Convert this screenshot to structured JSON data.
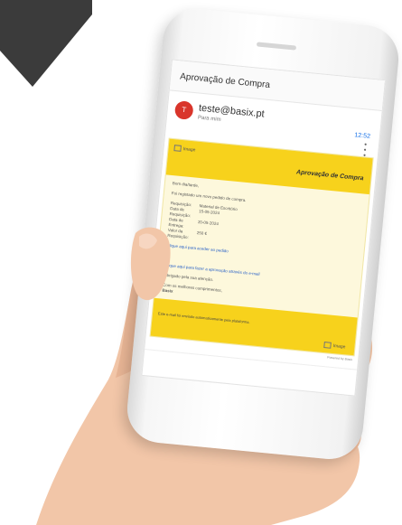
{
  "colors": {
    "arrow": "#3b3b3b",
    "email_header": "#f7d21c",
    "email_body_bg": "#fdf8dc",
    "avatar": "#d9352b",
    "skin": "#f2c6a8",
    "link": "#2a62c7"
  },
  "email_app": {
    "subject": "Aprovação de Compra",
    "sender": {
      "avatar_letter": "T",
      "email": "teste@basix.pt",
      "recipient": "Para mim",
      "date": "12:52"
    },
    "email": {
      "logo_alt": "Image",
      "title": "Aprovação de Compra",
      "greeting": "Bom dia/tarde,",
      "intro": "Foi registado um novo pedido de compra.",
      "details": [
        {
          "key": "Requisição:",
          "value": "Material de Escritório"
        },
        {
          "key": "Data de Requisição:",
          "value": "15-05-2024"
        },
        {
          "key": "Data de Entrega:",
          "value": "20-05-2024"
        },
        {
          "key": "Valor da Requisição:",
          "value": "250 €"
        }
      ],
      "link_1": "Clique aqui para aceder ao pedido",
      "separator": "ou",
      "link_2": "Clique aqui para fazer a aprovação através do e-mail",
      "closing_1": "Obrigado pela sua atenção.",
      "closing_2": "Com os melhores cumprimentos,",
      "signature": "Basix",
      "footer_text": "Este e-mail foi enviado automaticamente pela plataforma.",
      "footer_logo_alt": "Image",
      "fine_print": "Powered by Basix"
    }
  }
}
